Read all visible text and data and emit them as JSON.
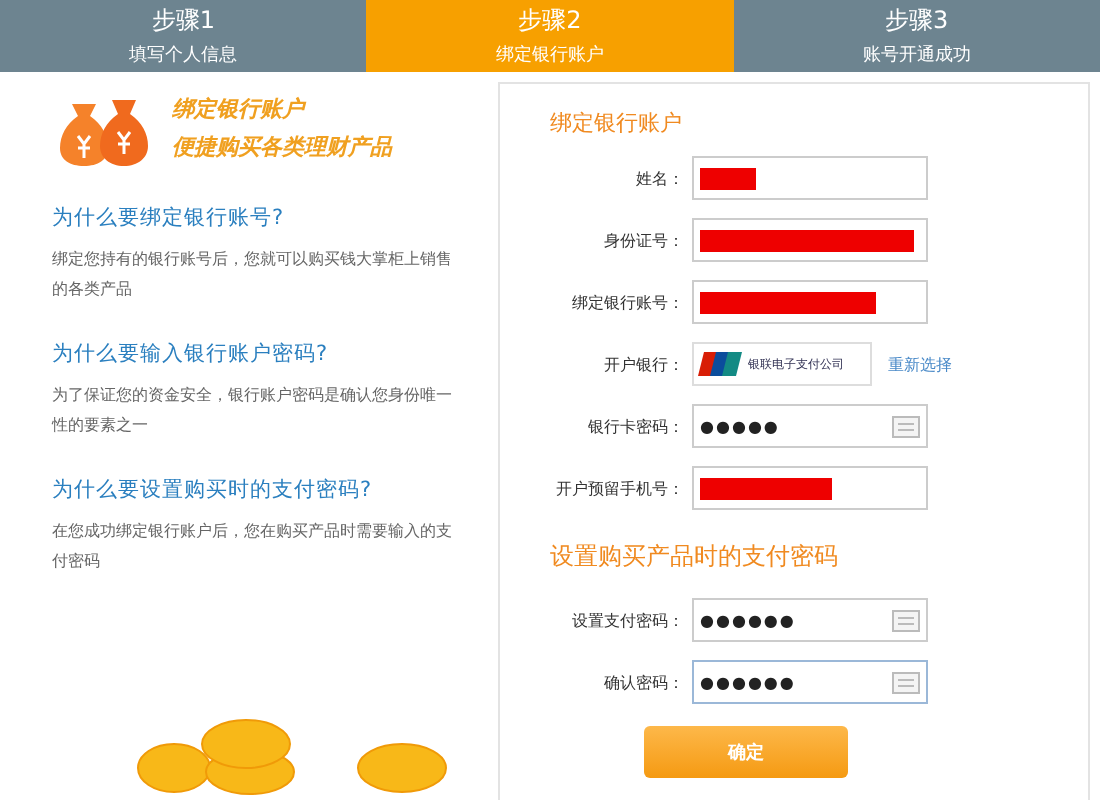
{
  "steps": [
    {
      "title": "步骤1",
      "subtitle": "填写个人信息",
      "selected": false
    },
    {
      "title": "步骤2",
      "subtitle": "绑定银行账户",
      "selected": true
    },
    {
      "title": "步骤3",
      "subtitle": "账号开通成功",
      "selected": false
    }
  ],
  "promo": {
    "line1": "绑定银行账户",
    "line2": "便捷购买各类理财产品"
  },
  "faq": [
    {
      "question": "为什么要绑定银行账号?",
      "answer": "绑定您持有的银行账号后，您就可以购买钱大掌柜上销售的各类产品"
    },
    {
      "question": "为什么要输入银行账户密码?",
      "answer": "为了保证您的资金安全，银行账户密码是确认您身份唯一性的要素之一"
    },
    {
      "question": "为什么要设置购买时的支付密码?",
      "answer": "在您成功绑定银行账户后，您在购买产品时需要输入的支付密码"
    }
  ],
  "bank_section": {
    "title": "绑定银行账户",
    "rows": [
      {
        "kind": "input",
        "label": "姓名：",
        "redacted": true
      },
      {
        "kind": "input",
        "label": "身份证号：",
        "redacted": true
      },
      {
        "kind": "input",
        "label": "绑定银行账号：",
        "redacted": true
      },
      {
        "kind": "bank",
        "label": "开户银行：",
        "bank_name": "银联电子支付公司",
        "link": "重新选择"
      },
      {
        "kind": "password",
        "label": "银行卡密码：",
        "value": "●●●●●",
        "focused": false
      },
      {
        "kind": "input",
        "label": "开户预留手机号：",
        "redacted": true
      }
    ]
  },
  "pay_section": {
    "title": "设置购买产品时的支付密码",
    "rows": [
      {
        "kind": "password",
        "label": "设置支付密码：",
        "value": "●●●●●●",
        "focused": false
      },
      {
        "kind": "password",
        "label": "确认密码：",
        "value": "●●●●●●",
        "focused": true
      }
    ]
  },
  "submit": "确定"
}
